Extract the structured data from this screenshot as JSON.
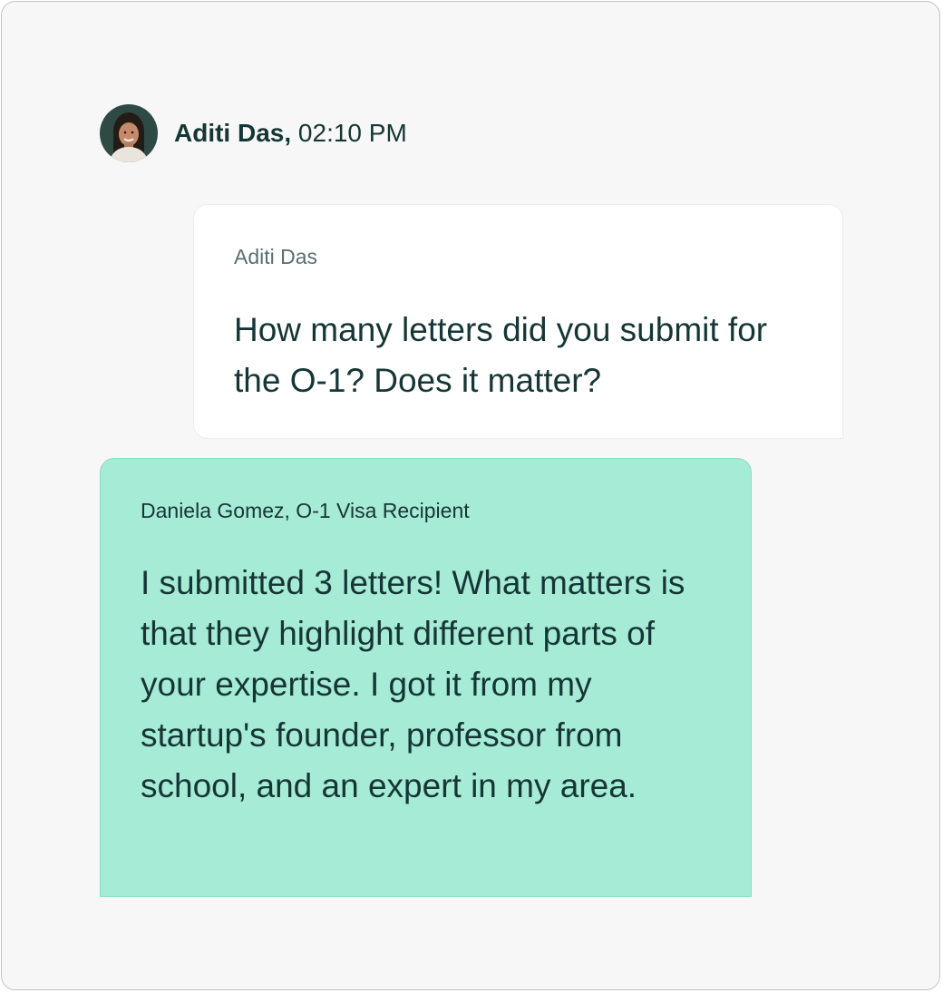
{
  "header": {
    "name": "Aditi Das",
    "separator": ",",
    "time": "02:10 PM"
  },
  "avatar": {
    "icon": "avatar-photo"
  },
  "question": {
    "author": "Aditi Das",
    "text": "How many letters did you submit for the O-1? Does it matter?"
  },
  "answer": {
    "author": "Daniela Gomez, O-1 Visa Recipient",
    "text": "I submitted 3 letters! What matters is that they highlight different parts of your expertise. I got it from my startup's founder, professor from school, and an expert in my area."
  },
  "colors": {
    "background": "#f7f7f7",
    "frame_border": "#c4c4c4",
    "question_bubble": "#ffffff",
    "answer_bubble": "#a6ebd6",
    "text_primary": "#163636",
    "text_secondary": "#5a6f6f"
  }
}
